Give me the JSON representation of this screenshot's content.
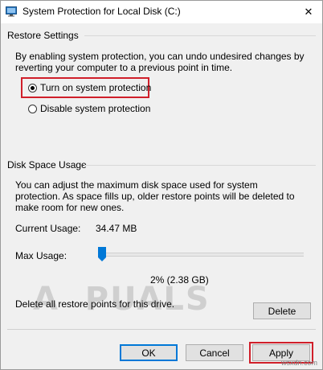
{
  "window": {
    "title": "System Protection for Local Disk (C:)",
    "close_glyph": "✕"
  },
  "restore": {
    "heading": "Restore Settings",
    "description": "By enabling system protection, you can undo undesired changes by reverting your computer to a previous point in time.",
    "options": [
      {
        "label": "Turn on system protection",
        "checked": true
      },
      {
        "label": "Disable system protection",
        "checked": false
      }
    ]
  },
  "disk": {
    "heading": "Disk Space Usage",
    "description": "You can adjust the maximum disk space used for system protection. As space fills up, older restore points will be deleted to make room for new ones.",
    "current_usage_label": "Current Usage:",
    "current_usage_value": "34.47 MB",
    "max_usage_label": "Max Usage:",
    "max_usage_percent": 2,
    "max_usage_text": "2% (2.38 GB)",
    "delete_text": "Delete all restore points for this drive.",
    "delete_button": "Delete"
  },
  "footer": {
    "ok_label": "OK",
    "cancel_label": "Cancel",
    "apply_label": "Apply"
  },
  "watermark": {
    "text": "A  PUALS",
    "site": "wsxdn.com"
  },
  "colors": {
    "highlight": "#d01f2a",
    "accent": "#0078d7"
  }
}
